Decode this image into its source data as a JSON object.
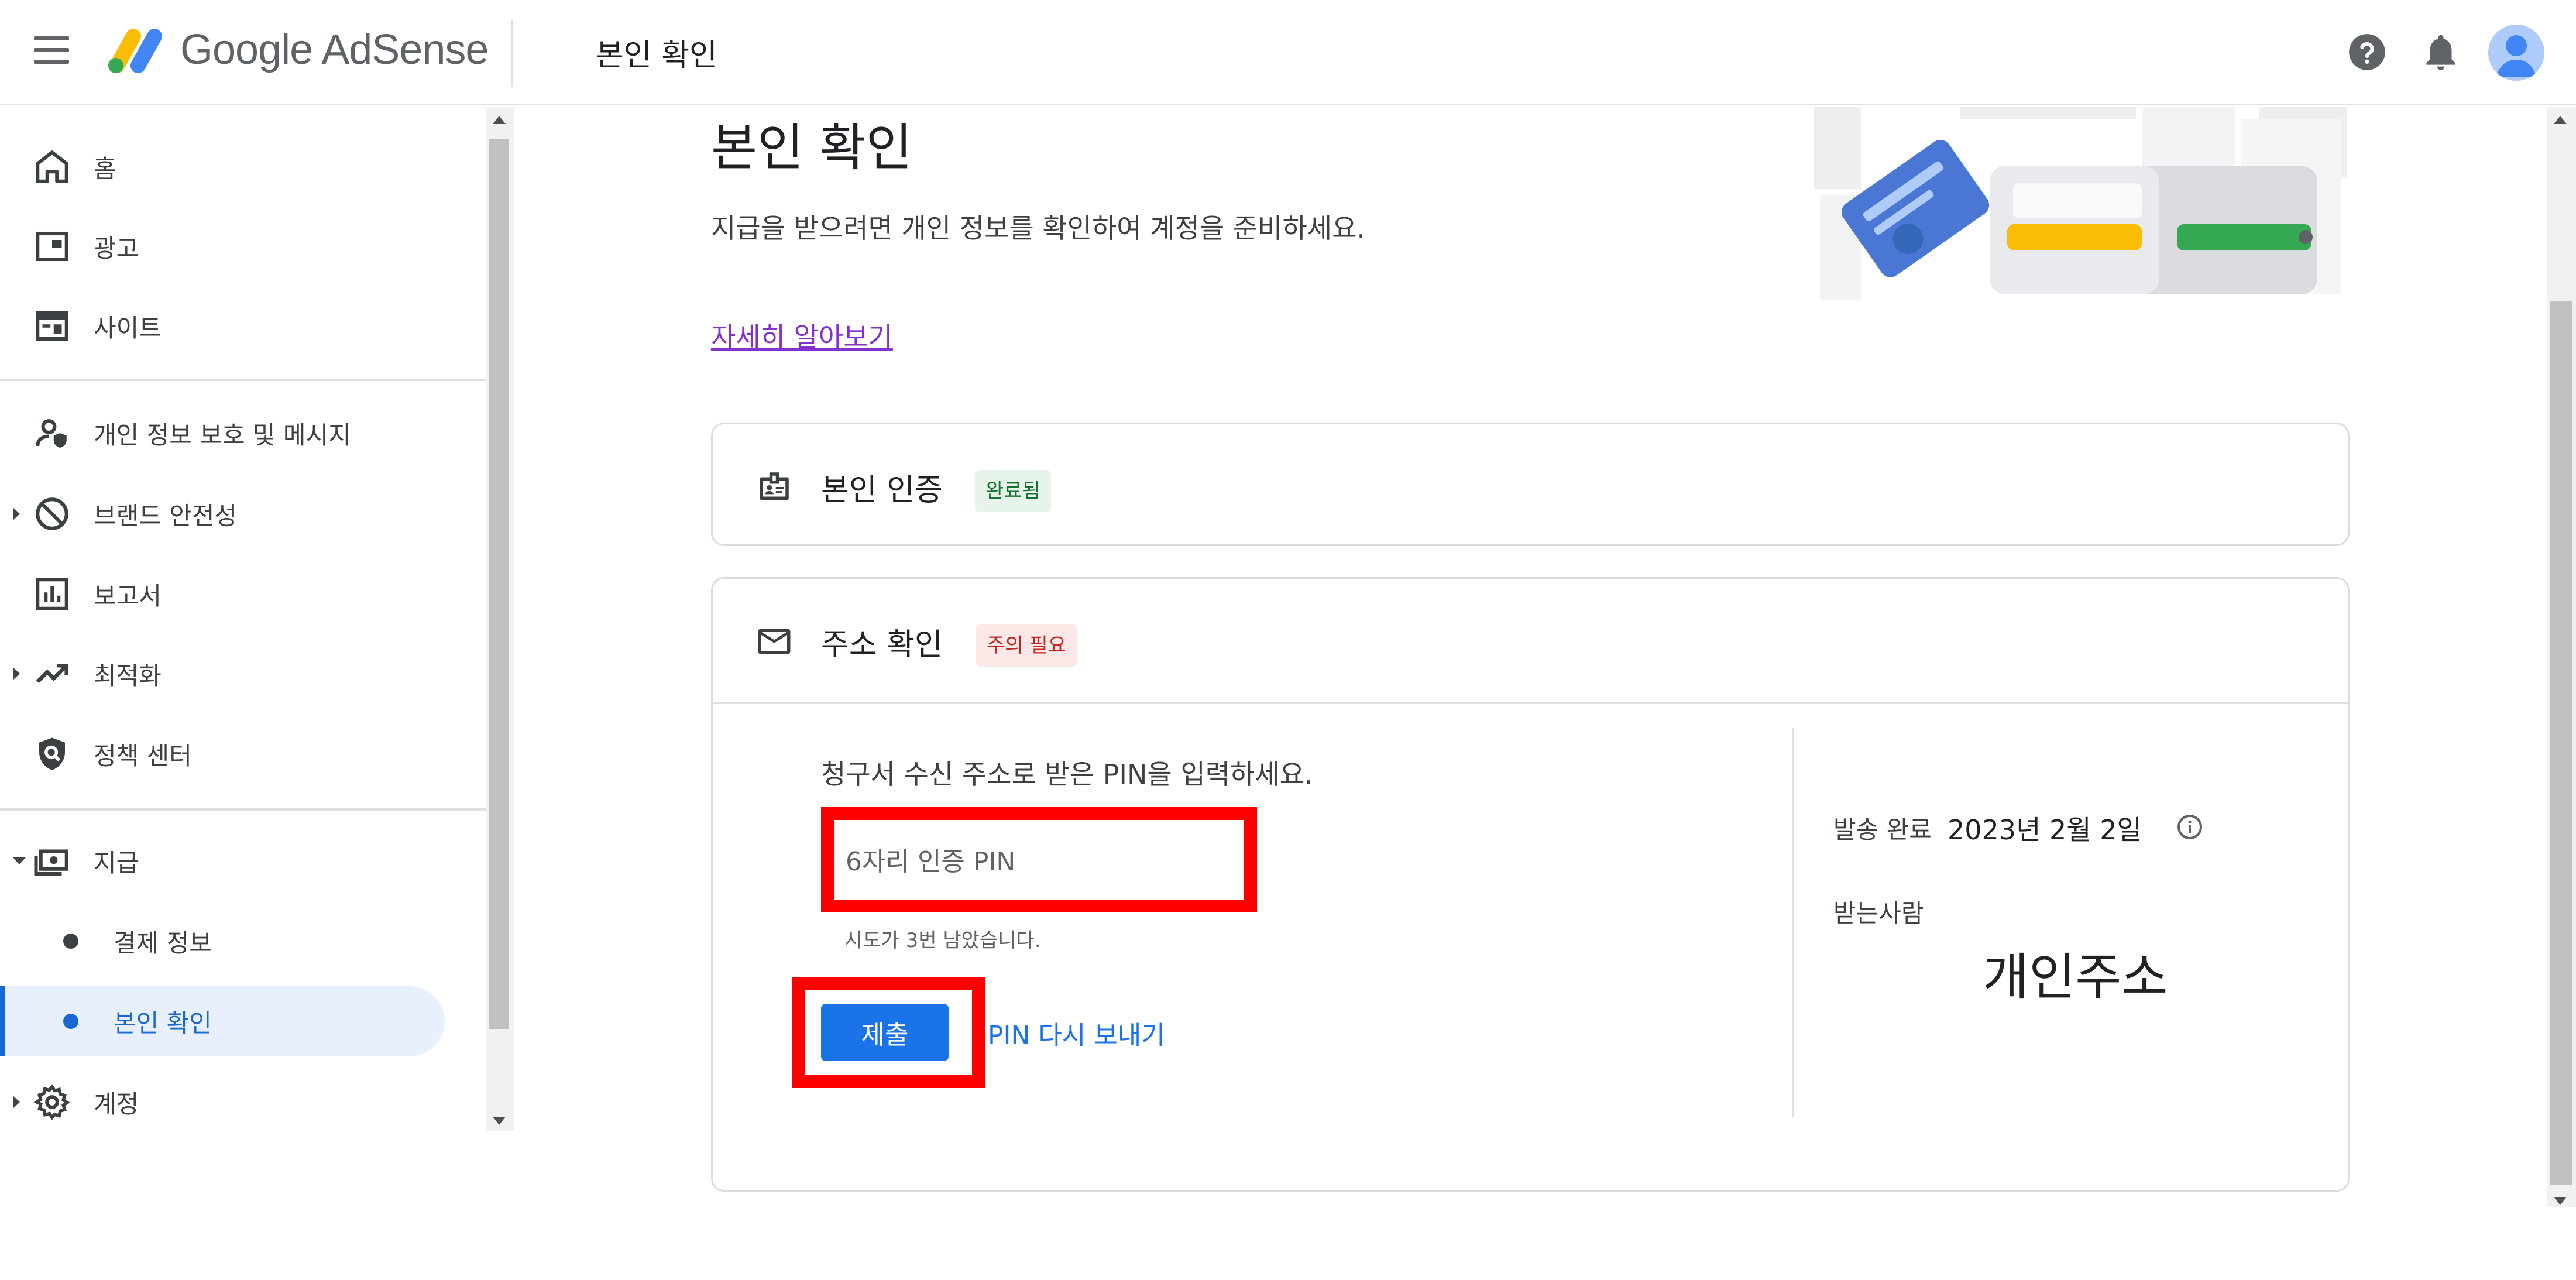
{
  "header": {
    "brand": "Google AdSense",
    "title": "본인 확인",
    "icons": [
      "menu-icon",
      "help-icon",
      "notifications-icon",
      "avatar"
    ]
  },
  "sidebar": {
    "items": [
      {
        "label": "홈",
        "icon": "home-icon"
      },
      {
        "label": "광고",
        "icon": "ads-icon"
      },
      {
        "label": "사이트",
        "icon": "sites-icon"
      },
      {
        "label": "개인 정보 보호 및 메시지",
        "icon": "privacy-icon"
      },
      {
        "label": "브랜드 안전성",
        "icon": "block-icon"
      },
      {
        "label": "보고서",
        "icon": "reports-icon"
      },
      {
        "label": "최적화",
        "icon": "trending-icon"
      },
      {
        "label": "정책 센터",
        "icon": "policy-icon"
      },
      {
        "label": "지급",
        "icon": "payments-icon"
      },
      {
        "label": "결제 정보"
      },
      {
        "label": "본인 확인"
      },
      {
        "label": "계정",
        "icon": "gear-icon"
      }
    ]
  },
  "main": {
    "heading": "본인 확인",
    "intro": "지급을 받으려면 개인 정보를 확인하여 계정을 준비하세요.",
    "learn_more": "자세히 알아보기",
    "identity": {
      "title": "본인 인증",
      "status": "완료됨"
    },
    "address": {
      "title": "주소 확인",
      "status": "주의 필요",
      "prompt": "청구서 수신 주소로 받은 PIN을 입력하세요.",
      "pin_placeholder": "6자리 인증 PIN",
      "tries": "시도가 3번 남았습니다.",
      "submit": "제출",
      "resend": "PIN 다시 보내기",
      "sent_label": "발송 완료",
      "sent_date": "2023년 2월 2일",
      "recipient_label": "받는사람",
      "recipient_value": "개인주소"
    }
  },
  "colors": {
    "primary": "#1a73e8",
    "highlight_box": "#ff0000",
    "success_bg": "#e6f4ea",
    "success_text": "#137333",
    "warn_bg": "#fce8e6",
    "warn_text": "#c5221f",
    "active_nav_bg": "#e8f0fe"
  }
}
